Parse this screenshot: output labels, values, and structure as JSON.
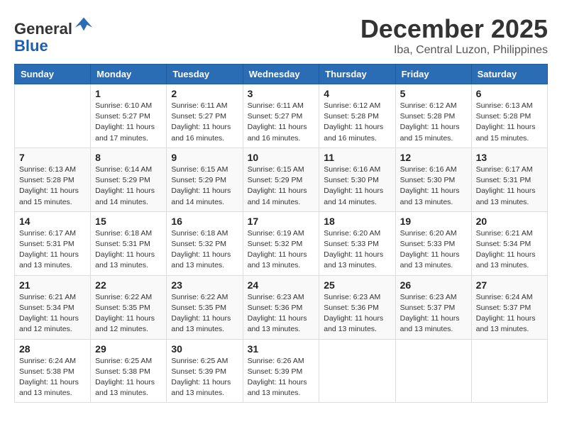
{
  "header": {
    "logo_line1": "General",
    "logo_line2": "Blue",
    "month_year": "December 2025",
    "location": "Iba, Central Luzon, Philippines"
  },
  "weekdays": [
    "Sunday",
    "Monday",
    "Tuesday",
    "Wednesday",
    "Thursday",
    "Friday",
    "Saturday"
  ],
  "weeks": [
    [
      {
        "day": "",
        "info": ""
      },
      {
        "day": "1",
        "info": "Sunrise: 6:10 AM\nSunset: 5:27 PM\nDaylight: 11 hours\nand 17 minutes."
      },
      {
        "day": "2",
        "info": "Sunrise: 6:11 AM\nSunset: 5:27 PM\nDaylight: 11 hours\nand 16 minutes."
      },
      {
        "day": "3",
        "info": "Sunrise: 6:11 AM\nSunset: 5:27 PM\nDaylight: 11 hours\nand 16 minutes."
      },
      {
        "day": "4",
        "info": "Sunrise: 6:12 AM\nSunset: 5:28 PM\nDaylight: 11 hours\nand 16 minutes."
      },
      {
        "day": "5",
        "info": "Sunrise: 6:12 AM\nSunset: 5:28 PM\nDaylight: 11 hours\nand 15 minutes."
      },
      {
        "day": "6",
        "info": "Sunrise: 6:13 AM\nSunset: 5:28 PM\nDaylight: 11 hours\nand 15 minutes."
      }
    ],
    [
      {
        "day": "7",
        "info": "Sunrise: 6:13 AM\nSunset: 5:28 PM\nDaylight: 11 hours\nand 15 minutes."
      },
      {
        "day": "8",
        "info": "Sunrise: 6:14 AM\nSunset: 5:29 PM\nDaylight: 11 hours\nand 14 minutes."
      },
      {
        "day": "9",
        "info": "Sunrise: 6:15 AM\nSunset: 5:29 PM\nDaylight: 11 hours\nand 14 minutes."
      },
      {
        "day": "10",
        "info": "Sunrise: 6:15 AM\nSunset: 5:29 PM\nDaylight: 11 hours\nand 14 minutes."
      },
      {
        "day": "11",
        "info": "Sunrise: 6:16 AM\nSunset: 5:30 PM\nDaylight: 11 hours\nand 14 minutes."
      },
      {
        "day": "12",
        "info": "Sunrise: 6:16 AM\nSunset: 5:30 PM\nDaylight: 11 hours\nand 13 minutes."
      },
      {
        "day": "13",
        "info": "Sunrise: 6:17 AM\nSunset: 5:31 PM\nDaylight: 11 hours\nand 13 minutes."
      }
    ],
    [
      {
        "day": "14",
        "info": "Sunrise: 6:17 AM\nSunset: 5:31 PM\nDaylight: 11 hours\nand 13 minutes."
      },
      {
        "day": "15",
        "info": "Sunrise: 6:18 AM\nSunset: 5:31 PM\nDaylight: 11 hours\nand 13 minutes."
      },
      {
        "day": "16",
        "info": "Sunrise: 6:18 AM\nSunset: 5:32 PM\nDaylight: 11 hours\nand 13 minutes."
      },
      {
        "day": "17",
        "info": "Sunrise: 6:19 AM\nSunset: 5:32 PM\nDaylight: 11 hours\nand 13 minutes."
      },
      {
        "day": "18",
        "info": "Sunrise: 6:20 AM\nSunset: 5:33 PM\nDaylight: 11 hours\nand 13 minutes."
      },
      {
        "day": "19",
        "info": "Sunrise: 6:20 AM\nSunset: 5:33 PM\nDaylight: 11 hours\nand 13 minutes."
      },
      {
        "day": "20",
        "info": "Sunrise: 6:21 AM\nSunset: 5:34 PM\nDaylight: 11 hours\nand 13 minutes."
      }
    ],
    [
      {
        "day": "21",
        "info": "Sunrise: 6:21 AM\nSunset: 5:34 PM\nDaylight: 11 hours\nand 12 minutes."
      },
      {
        "day": "22",
        "info": "Sunrise: 6:22 AM\nSunset: 5:35 PM\nDaylight: 11 hours\nand 12 minutes."
      },
      {
        "day": "23",
        "info": "Sunrise: 6:22 AM\nSunset: 5:35 PM\nDaylight: 11 hours\nand 13 minutes."
      },
      {
        "day": "24",
        "info": "Sunrise: 6:23 AM\nSunset: 5:36 PM\nDaylight: 11 hours\nand 13 minutes."
      },
      {
        "day": "25",
        "info": "Sunrise: 6:23 AM\nSunset: 5:36 PM\nDaylight: 11 hours\nand 13 minutes."
      },
      {
        "day": "26",
        "info": "Sunrise: 6:23 AM\nSunset: 5:37 PM\nDaylight: 11 hours\nand 13 minutes."
      },
      {
        "day": "27",
        "info": "Sunrise: 6:24 AM\nSunset: 5:37 PM\nDaylight: 11 hours\nand 13 minutes."
      }
    ],
    [
      {
        "day": "28",
        "info": "Sunrise: 6:24 AM\nSunset: 5:38 PM\nDaylight: 11 hours\nand 13 minutes."
      },
      {
        "day": "29",
        "info": "Sunrise: 6:25 AM\nSunset: 5:38 PM\nDaylight: 11 hours\nand 13 minutes."
      },
      {
        "day": "30",
        "info": "Sunrise: 6:25 AM\nSunset: 5:39 PM\nDaylight: 11 hours\nand 13 minutes."
      },
      {
        "day": "31",
        "info": "Sunrise: 6:26 AM\nSunset: 5:39 PM\nDaylight: 11 hours\nand 13 minutes."
      },
      {
        "day": "",
        "info": ""
      },
      {
        "day": "",
        "info": ""
      },
      {
        "day": "",
        "info": ""
      }
    ]
  ]
}
